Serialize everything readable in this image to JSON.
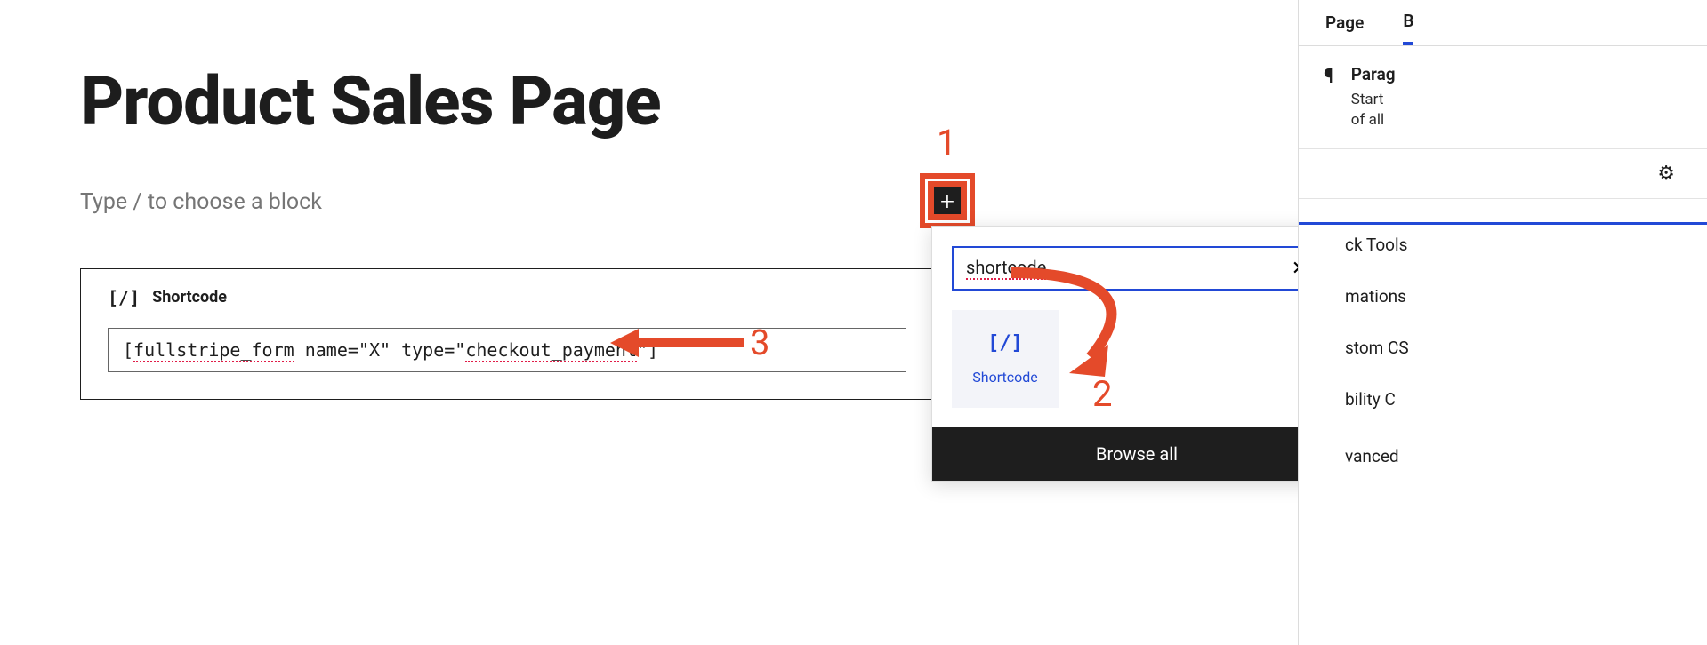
{
  "editor": {
    "title": "Product Sales Page",
    "placeholder": "Type / to choose a block"
  },
  "shortcode_block": {
    "icon_text": "[/]",
    "label": "Shortcode",
    "value_parts": {
      "p1": "[",
      "p2": "fullstripe_form",
      "p3": " name=\"X\" type=\"",
      "p4": "checkout_payment",
      "p5": "\"]"
    }
  },
  "inserter": {
    "search_value": "shortcode",
    "close_glyph": "✕",
    "result_tile": {
      "icon_text": "[/]",
      "label": "Shortcode"
    },
    "browse_all": "Browse all"
  },
  "add_button": {
    "glyph": "+"
  },
  "annotations": {
    "one": "1",
    "two": "2",
    "three": "3"
  },
  "sidebar": {
    "tab_page": "Page",
    "tab_block_partial": "B",
    "block_info": {
      "icon_glyph": "¶",
      "title_partial": "Parag",
      "desc_line1_partial": "Start",
      "desc_line2_partial": "of all"
    },
    "gear_glyph": "⚙",
    "items_partial": {
      "block_tools": "ck Tools",
      "animations": "mations",
      "custom_css": "stom CS",
      "visibility": "bility C",
      "advanced": "vanced"
    }
  }
}
